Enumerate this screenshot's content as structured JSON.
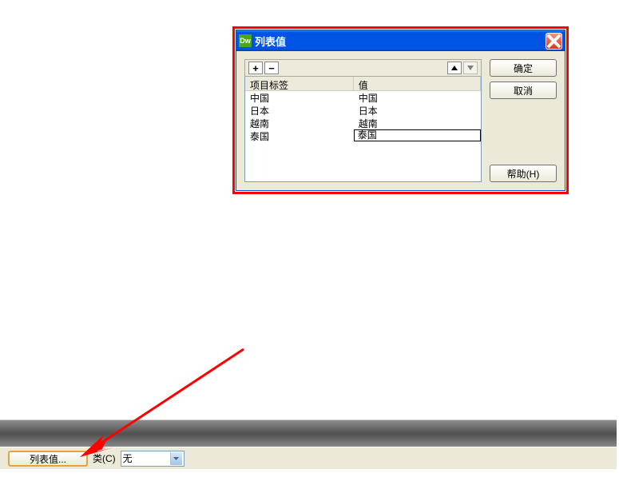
{
  "dialog": {
    "title": "列表值",
    "app_icon_text": "Dw",
    "columns": {
      "label": "项目标签",
      "value": "值"
    },
    "rows": [
      {
        "label": "中国",
        "value": "中国"
      },
      {
        "label": "日本",
        "value": "日本"
      },
      {
        "label": "越南",
        "value": "越南"
      },
      {
        "label": "泰国",
        "value": "泰国",
        "editing": true
      }
    ],
    "buttons": {
      "ok": "确定",
      "cancel": "取消",
      "help": "帮助(H)"
    },
    "toolbar": {
      "add": "+",
      "remove": "−"
    }
  },
  "property": {
    "list_values_btn": "列表值...",
    "class_label": "类(C)",
    "class_value": "无"
  }
}
